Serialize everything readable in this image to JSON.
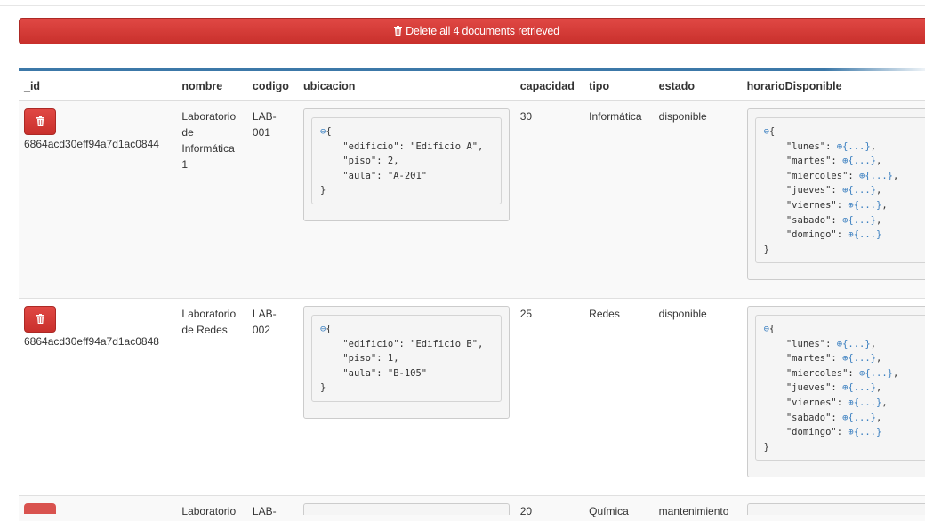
{
  "toolbar": {
    "delete_all_label": "Delete all 4 documents retrieved"
  },
  "columns": [
    "_id",
    "nombre",
    "codigo",
    "ubicacion",
    "capacidad",
    "tipo",
    "estado",
    "horarioDisponible"
  ],
  "rows": [
    {
      "_id": "6864acd30eff94a7d1ac0844",
      "nombre": "Laboratorio de Informática 1",
      "codigo": "LAB-001",
      "ubicacion_lines": [
        "⊖{",
        "    \"edificio\": \"Edificio A\",",
        "    \"piso\": 2,",
        "    \"aula\": \"A-201\"",
        "}"
      ],
      "capacidad": "30",
      "tipo": "Informática",
      "estado": "disponible"
    },
    {
      "_id": "6864acd30eff94a7d1ac0848",
      "nombre": "Laboratorio de Redes",
      "codigo": "LAB-002",
      "ubicacion_lines": [
        "⊖{",
        "    \"edificio\": \"Edificio B\",",
        "    \"piso\": 1,",
        "    \"aula\": \"B-105\"",
        "}"
      ],
      "capacidad": "25",
      "tipo": "Redes",
      "estado": "disponible"
    }
  ],
  "horario_lines": [
    "⊖{",
    "    \"lunes\": ⊕{...},",
    "    \"martes\": ⊕{...},",
    "    \"miercoles\": ⊕{...},",
    "    \"jueves\": ⊕{...},",
    "    \"viernes\": ⊕{...},",
    "    \"sabado\": ⊕{...},",
    "    \"domingo\": ⊕{...}",
    "}"
  ],
  "partial_row": {
    "nombre": "Laboratorio",
    "codigo": "LAB-",
    "capacidad": "20",
    "tipo": "Química",
    "estado": "mantenimiento"
  },
  "icons": {
    "delete": "trash-icon",
    "collapse": "minus-circle-icon",
    "expand": "plus-circle-icon"
  },
  "colors": {
    "danger": "#d9534f",
    "header_rule": "#3c78a8",
    "link": "#3a7fc0"
  }
}
